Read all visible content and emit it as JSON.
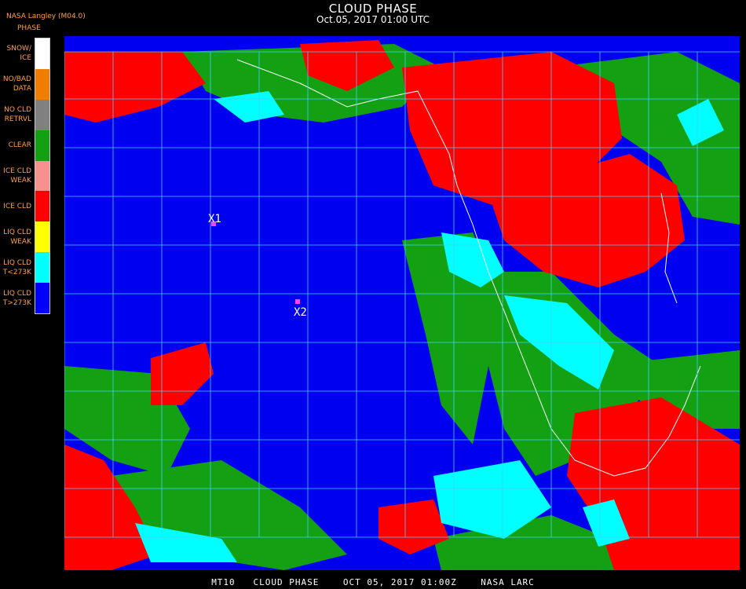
{
  "header": {
    "title": "CLOUD PHASE",
    "datetime": "Oct.05, 2017 01:00 UTC",
    "producer": "NASA Langley (M04.0)"
  },
  "legend": {
    "title": "PHASE",
    "items": [
      {
        "label": "SNOW/\nICE",
        "color": "#ffffff"
      },
      {
        "label": "NO/BAD\nDATA",
        "color": "#f07d00"
      },
      {
        "label": "NO CLD\nRETRVL",
        "color": "#808080"
      },
      {
        "label": "CLEAR",
        "color": "#13a013"
      },
      {
        "label": "ICE CLD\nWEAK",
        "color": "#f89090"
      },
      {
        "label": "ICE CLD",
        "color": "#ff0000"
      },
      {
        "label": "LIQ CLD\nWEAK",
        "color": "#ffff00"
      },
      {
        "label": "LIQ CLD\nT<273K",
        "color": "#00ffff"
      },
      {
        "label": "LIQ CLD\nT>273K",
        "color": "#0000ff"
      }
    ]
  },
  "markers": [
    {
      "label": "X1",
      "color": "#ff40ff"
    },
    {
      "label": "X2",
      "color": "#ff40ff"
    }
  ],
  "colors": {
    "ocean": "#0000f0",
    "land_clear": "#13a013",
    "ice_cloud": "#ff0000",
    "liquid_cold": "#00ffff",
    "grid": "#40d0ff",
    "coastline": "#ffffff"
  },
  "footer": "MT10   CLOUD PHASE    OCT 05, 2017 01:00Z    NASA LARC"
}
